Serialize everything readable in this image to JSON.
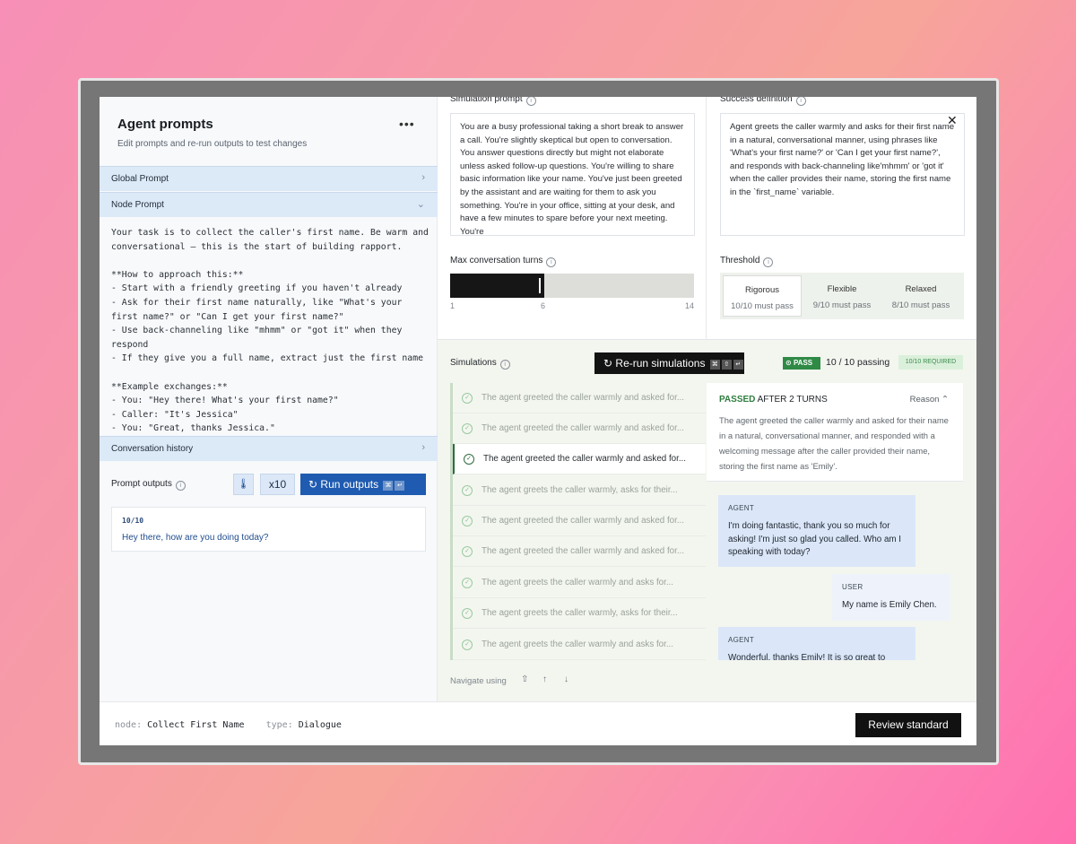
{
  "left_panel": {
    "title": "Agent prompts",
    "subtitle": "Edit prompts and re-run outputs to test changes",
    "more_icon": "more-horizontal-icon",
    "global_prompt": "Global Prompt",
    "node_prompt": "Node Prompt",
    "node_prompt_text": "Your task is to collect the caller's first name. Be warm and conversational – this is the start of building rapport.\n\n**How to approach this:**\n- Start with a friendly greeting if you haven't already\n- Ask for their first name naturally, like \"What's your first name?\" or \"Can I get your first name?\"\n- Use back-channeling like \"mhmm\" or \"got it\" when they respond\n- If they give you a full name, extract just the first name\n\n**Example exchanges:**\n- You: \"Hey there! What's your first name?\"\n- Caller: \"It's Jessica\"\n- You: \"Great, thanks Jessica.\"",
    "conversation_history": "Conversation history",
    "prompt_outputs_label": "Prompt outputs",
    "x10_label": "x10",
    "run_outputs_label": "Run outputs",
    "output_count": "10/10",
    "output_text": "Hey there, how are you doing today?"
  },
  "upper": {
    "simulation_prompt_label": "Simulation prompt",
    "simulation_prompt_text": "You are a busy professional taking a short break to answer a call. You're slightly skeptical but open to conversation. You answer questions directly but might not elaborate unless asked follow-up questions. You're willing to share basic information like your name. You've just been greeted by the assistant and are waiting for them to ask you something. You're in your office, sitting at your desk, and have a few minutes to spare before your next meeting. You're",
    "success_definition_label": "Success definition",
    "success_definition_text": "Agent greets the caller warmly and asks for their first name in a natural, conversational manner, using phrases like 'What's your first name?' or 'Can I get your first name?', and responds with back-channeling like'mhmm' or 'got it' when the caller provides their name, storing the first name in the `first_name` variable.",
    "max_turns_label": "Max conversation turns",
    "max_turns_min": "1",
    "max_turns_value": "6",
    "max_turns_max": "14",
    "threshold_label": "Threshold",
    "threshold_options": [
      {
        "name": "Rigorous",
        "sub": "10/10 must pass"
      },
      {
        "name": "Flexible",
        "sub": "9/10 must pass"
      },
      {
        "name": "Relaxed",
        "sub": "8/10 must pass"
      }
    ]
  },
  "simulations": {
    "label": "Simulations",
    "rerun_label": "Re-run simulations",
    "pass_badge": "PASS",
    "passing_count": "10 / 10 passing",
    "required_badge": "10/10 REQUIRED",
    "rows": [
      "The agent greeted the caller warmly and asked for...",
      "The agent greeted the caller warmly and asked for...",
      "The agent greeted the caller warmly and asked for...",
      "The agent greets the caller warmly, asks for their...",
      "The agent greeted the caller warmly and asked for...",
      "The agent greeted the caller warmly and asked for...",
      "The agent greets the caller warmly and asks for...",
      "The agent greets the caller warmly, asks for their...",
      "The agent greets the caller warmly and asks for..."
    ],
    "selected_index": 2,
    "navigate_hint": "Navigate using",
    "detail": {
      "passed": "PASSED",
      "after": "AFTER 2 TURNS",
      "reason_toggle": "Reason",
      "reason_text": "The agent greeted the caller warmly and asked for their name in a natural, conversational manner, and responded with a welcoming message after the caller provided their name, storing the first name as 'Emily'.",
      "messages": [
        {
          "role": "AGENT",
          "text": "I'm doing fantastic, thank you so much for asking! I'm just so glad you called. Who am I speaking with today?"
        },
        {
          "role": "USER",
          "text": "My name is Emily Chen."
        },
        {
          "role": "AGENT",
          "text": "Wonderful, thanks Emily! It is so great to"
        }
      ]
    }
  },
  "footer": {
    "node_key": "node:",
    "node_value": "Collect First Name",
    "type_key": "type:",
    "type_value": "Dialogue",
    "review_label": "Review standard"
  },
  "colors": {
    "primary_blue": "#1f5bb0",
    "pass_green": "#2f8a46",
    "accordion_bg": "#dce9f7"
  }
}
